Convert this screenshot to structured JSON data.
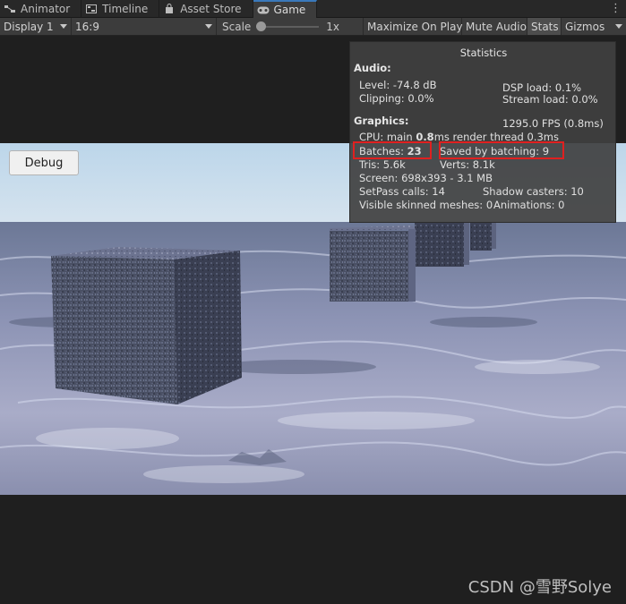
{
  "tabs": [
    {
      "label": "Animator",
      "icon": "animator-icon"
    },
    {
      "label": "Timeline",
      "icon": "timeline-icon"
    },
    {
      "label": "Asset Store",
      "icon": "store-icon"
    },
    {
      "label": "Game",
      "icon": "gamepad-icon",
      "active": true
    }
  ],
  "toolbar": {
    "display": "Display 1",
    "aspect": "16:9",
    "scale_label": "Scale",
    "scale_value": "1x",
    "scale_level": 0,
    "maximize": "Maximize On Play",
    "mute": "Mute Audio",
    "stats": "Stats",
    "gizmos": "Gizmos"
  },
  "game": {
    "debug_button": "Debug"
  },
  "stats_panel": {
    "title": "Statistics",
    "audio_header": "Audio:",
    "level": "Level: -74.8 dB",
    "clipping": "Clipping: 0.0%",
    "dsp": "DSP load: 0.1%",
    "stream": "Stream load: 0.0%",
    "graphics_header": "Graphics:",
    "fps": "1295.0 FPS (0.8ms)",
    "cpu_prefix": "CPU: main ",
    "cpu_main": "0.8",
    "cpu_suffix": "ms  render thread 0.3ms",
    "batches_label": "Batches: ",
    "batches_value": "23",
    "saved": "Saved by batching: 9",
    "tris": "Tris: 5.6k",
    "verts": "Verts: 8.1k",
    "screen": "Screen: 698x393 - 3.1 MB",
    "setpass": "SetPass calls: 14",
    "shadow": "Shadow casters: 10",
    "skinned": "Visible skinned meshes: 0",
    "animations": "Animations: 0"
  },
  "watermark": "CSDN @雪野Solye",
  "colors": {
    "highlight": "#e02020",
    "active_tab_accent": "#3a79bb"
  }
}
